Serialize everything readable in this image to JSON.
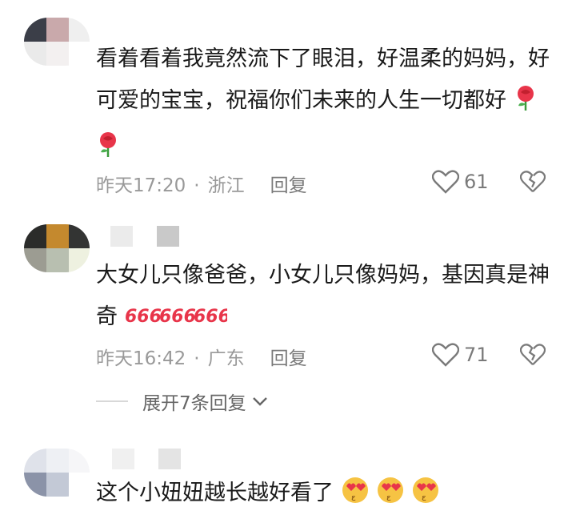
{
  "comments": [
    {
      "text": "看着看着我竟然流下了眼泪，好温柔的妈妈，好可爱的宝宝，祝福你们未来的人生一切都好",
      "time": "昨天17:20",
      "location": "浙江",
      "reply_label": "回复",
      "likes": "61",
      "emoji": "rose-icon"
    },
    {
      "text": "大女儿只像爸爸，小女儿只像妈妈，基因真是神奇",
      "time": "昨天16:42",
      "location": "广东",
      "reply_label": "回复",
      "likes": "71",
      "emoji": "666-icon"
    },
    {
      "text": "这个小妞妞越长越好看了",
      "emoji": "heart-eyes-icon"
    }
  ],
  "expand_replies": "展开7条回复",
  "colors": {
    "text": "#1a1a1a",
    "meta": "#999999",
    "emoji_red": "#e8354a"
  }
}
